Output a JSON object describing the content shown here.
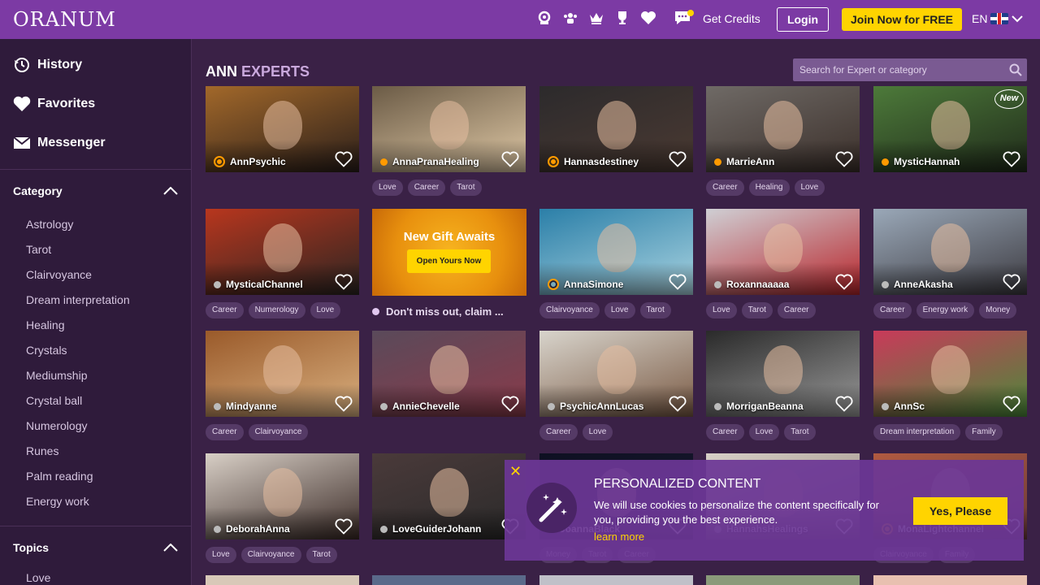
{
  "header": {
    "logo": "ORANUM",
    "get_credits": "Get Credits",
    "login": "Login",
    "join": "Join Now for FREE",
    "lang": "EN",
    "icons": [
      "psychic-icon",
      "group-icon",
      "crown-icon",
      "trophy-icon",
      "heart-icon",
      "messages-icon"
    ]
  },
  "sidebar": {
    "links": [
      {
        "label": "History",
        "icon": "history-icon"
      },
      {
        "label": "Favorites",
        "icon": "heart-icon"
      },
      {
        "label": "Messenger",
        "icon": "envelope-icon"
      }
    ],
    "category_title": "Category",
    "categories": [
      "Astrology",
      "Tarot",
      "Clairvoyance",
      "Dream interpretation",
      "Healing",
      "Crystals",
      "Mediumship",
      "Crystal ball",
      "Numerology",
      "Runes",
      "Palm reading",
      "Energy work"
    ],
    "topics_title": "Topics",
    "topics": [
      "Love"
    ]
  },
  "main": {
    "title_bold": "ANN",
    "title_light": "EXPERTS",
    "search_placeholder": "Search for Expert or category",
    "new_badge": "New",
    "gift": {
      "title": "New Gift Awaits",
      "button": "Open Yours Now",
      "text": "Don't miss out, claim ..."
    },
    "experts": [
      {
        "name": "AnnPsychic",
        "status": "ring",
        "tags": [],
        "colors": [
          "#a2682a",
          "#2a1e1a"
        ]
      },
      {
        "name": "AnnaPranaHealing",
        "status": "orange",
        "tags": [
          "Love",
          "Career",
          "Tarot"
        ],
        "colors": [
          "#6b5b46",
          "#e0c9a6"
        ]
      },
      {
        "name": "Hannasdestiney",
        "status": "ring",
        "tags": [],
        "colors": [
          "#2c2a2c",
          "#4b3a32"
        ]
      },
      {
        "name": "MarrieAnn",
        "status": "orange",
        "tags": [
          "Career",
          "Healing",
          "Love"
        ],
        "colors": [
          "#6f6a66",
          "#3b2f2a"
        ]
      },
      {
        "name": "MysticHannah",
        "status": "orange",
        "tags": [],
        "colors": [
          "#4d7a3a",
          "#1f2a1a"
        ],
        "new": true
      },
      {
        "name": "MysticalChannel",
        "status": "grey",
        "tags": [
          "Career",
          "Numerology",
          "Love"
        ],
        "colors": [
          "#b8361e",
          "#2b2522"
        ]
      },
      {
        "name": "AnnaSimone",
        "status": "ringblue",
        "tags": [
          "Clairvoyance",
          "Love",
          "Tarot"
        ],
        "colors": [
          "#2b7fa8",
          "#a9d3e0"
        ]
      },
      {
        "name": "Roxannaaaaa",
        "status": "grey",
        "tags": [
          "Love",
          "Tarot",
          "Career"
        ],
        "colors": [
          "#cfcfd4",
          "#b8242a"
        ]
      },
      {
        "name": "AnneAkasha",
        "status": "grey",
        "tags": [
          "Career",
          "Energy work",
          "Money"
        ],
        "colors": [
          "#9aa8b8",
          "#3c3a40"
        ]
      },
      {
        "name": "Mindyanne",
        "status": "grey",
        "tags": [
          "Career",
          "Clairvoyance"
        ],
        "colors": [
          "#9a5a2a",
          "#d9b080"
        ]
      },
      {
        "name": "AnnieChevelle",
        "status": "grey",
        "tags": [],
        "colors": [
          "#5a4a5a",
          "#8a3a4a"
        ]
      },
      {
        "name": "PsychicAnnLucas",
        "status": "grey",
        "tags": [
          "Career",
          "Love"
        ],
        "colors": [
          "#d8d4cc",
          "#7a5a44"
        ]
      },
      {
        "name": "MorriganBeanna",
        "status": "grey",
        "tags": [
          "Career",
          "Love",
          "Tarot"
        ],
        "colors": [
          "#2a2a2a",
          "#9a9a9a"
        ]
      },
      {
        "name": "AnnSc",
        "status": "grey",
        "tags": [
          "Dream interpretation",
          "Family"
        ],
        "colors": [
          "#c93a5a",
          "#4a8a3a"
        ]
      },
      {
        "name": "DeborahAnna",
        "status": "grey",
        "tags": [
          "Love",
          "Clairvoyance",
          "Tarot"
        ],
        "colors": [
          "#d8cfc6",
          "#3a2a26"
        ]
      },
      {
        "name": "LoveGuiderJohann",
        "status": "grey",
        "tags": [],
        "colors": [
          "#4a3a3a",
          "#2a2a2a"
        ]
      },
      {
        "name": "JoannaBlack",
        "status": "grey",
        "tags": [
          "Money",
          "Tarot",
          "Career"
        ],
        "colors": [
          "#0e1022",
          "#1a1a30"
        ]
      },
      {
        "name": "HannahsHealings",
        "status": "grey",
        "tags": [],
        "colors": [
          "#d8d0c8",
          "#8a7a70"
        ]
      },
      {
        "name": "MonaLightchannel",
        "status": "ring",
        "tags": [
          "Clairvoyance",
          "Family"
        ],
        "colors": [
          "#b05a40",
          "#6a3a3a"
        ]
      }
    ]
  },
  "cookie": {
    "close": "✕",
    "title": "PERSONALIZED CONTENT",
    "text": "We will use cookies to personalize the content specifically for you, providing you the best experience.",
    "learn": "learn more",
    "button": "Yes, Please"
  }
}
